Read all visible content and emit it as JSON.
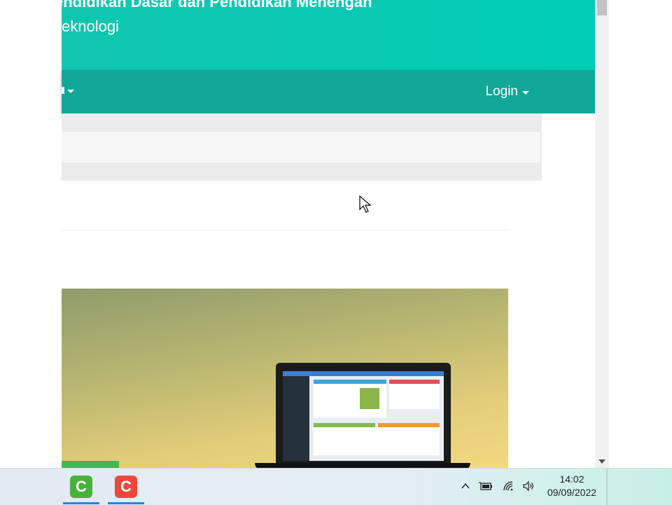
{
  "header": {
    "title": "endidikan Dasar dan Pendidikan Menengan",
    "subtitle": "eknologi"
  },
  "navbar": {
    "login_label": "Login"
  },
  "taskbar": {
    "apps": [
      {
        "name": "camtasia-green",
        "glyph": "C",
        "color": "#48b13b"
      },
      {
        "name": "camtasia-red",
        "glyph": "C",
        "color": "#ea4a3c"
      }
    ],
    "tray_icons": [
      "chevron-up-icon",
      "battery-icon",
      "wifi-icon",
      "volume-icon"
    ],
    "clock_time": "14:02",
    "clock_date": "09/09/2022"
  },
  "colors": {
    "header": "#00cdb5",
    "navbar": "#11a898",
    "page_gray": "#ebebeb"
  }
}
